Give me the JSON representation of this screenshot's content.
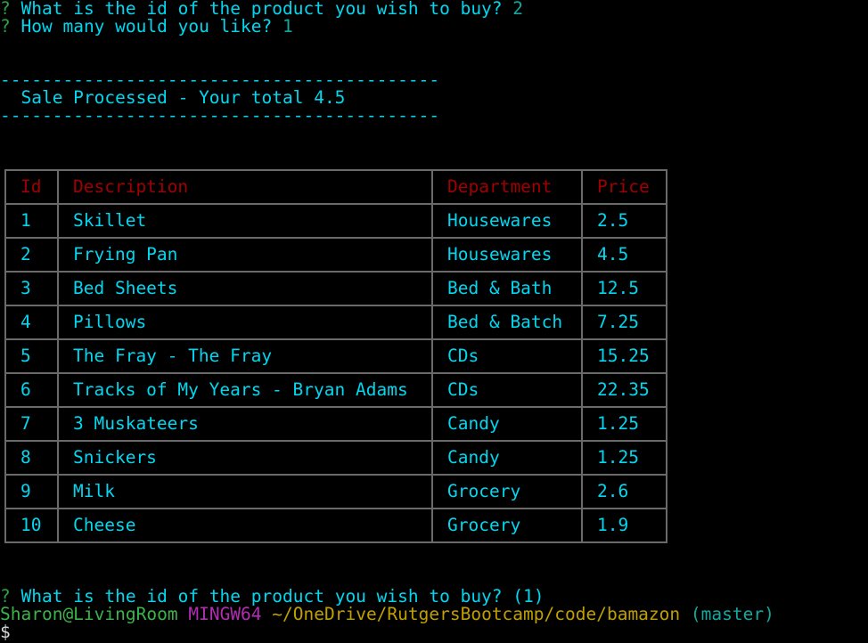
{
  "colors": {
    "background": "#000000",
    "prompt_mark": "#2ea043",
    "prompt_text": "#00d7f0",
    "answer": "#13a89e",
    "table_header": "#a00000",
    "table_text": "#00d7f0",
    "table_border": "#6a6a6a",
    "user_host": "#3cb44b",
    "mingw": "#b22db2",
    "path": "#c0a000"
  },
  "prompt1": {
    "mark": "?",
    "question": "What is the id of the product you wish to buy?",
    "answer": "2"
  },
  "prompt2": {
    "mark": "?",
    "question": "How many would you like?",
    "answer": "1"
  },
  "sale": {
    "rule": "------------------------------------------",
    "message": "Sale Processed - Your total 4.5"
  },
  "table": {
    "headers": [
      "Id",
      "Description",
      "Department",
      "Price"
    ],
    "rows": [
      [
        "1",
        "Skillet",
        "Housewares",
        "2.5"
      ],
      [
        "2",
        "Frying Pan",
        "Housewares",
        "4.5"
      ],
      [
        "3",
        "Bed Sheets",
        "Bed & Bath",
        "12.5"
      ],
      [
        "4",
        "Pillows",
        "Bed & Batch",
        "7.25"
      ],
      [
        "5",
        "The Fray - The Fray",
        "CDs",
        "15.25"
      ],
      [
        "6",
        "Tracks of My Years - Bryan Adams",
        "CDs",
        "22.35"
      ],
      [
        "7",
        "3 Muskateers",
        "Candy",
        "1.25"
      ],
      [
        "8",
        "Snickers",
        "Candy",
        "1.25"
      ],
      [
        "9",
        "Milk",
        "Grocery",
        "2.6"
      ],
      [
        "10",
        "Cheese",
        "Grocery",
        "1.9"
      ]
    ]
  },
  "prompt3": {
    "mark": "?",
    "question": "What is the id of the product you wish to buy? (1)"
  },
  "shell": {
    "user_host": "Sharon@LivingRoom",
    "system": "MINGW64",
    "path": "~/OneDrive/RutgersBootcamp/code/bamazon",
    "branch": "(master)",
    "cursor": "$"
  }
}
